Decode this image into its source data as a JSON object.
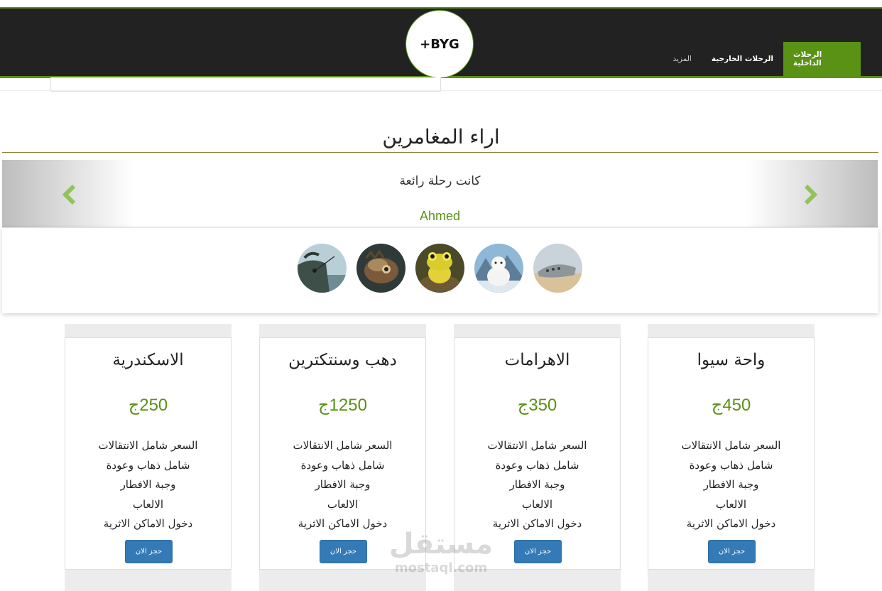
{
  "header": {
    "logo_text": "+BYG",
    "nav": [
      {
        "label": "الرحلات الداخلية",
        "active": true
      },
      {
        "label": "الرحلات الخارجية",
        "active": false
      },
      {
        "label": "المزيد",
        "active": false
      }
    ]
  },
  "testimonials": {
    "title": "اراء المغامرين",
    "quote": "كانت رحلة رائعة",
    "author": "Ahmed",
    "avatars": [
      "fisherman-photo",
      "steampunk-fish-photo",
      "frog-photo",
      "polar-bear-photo",
      "crashed-plane-photo"
    ]
  },
  "cards": [
    {
      "title": "واحة سيوا",
      "price": "450ج",
      "features": [
        "السعر شامل الانتقالات",
        "شامل ذهاب وعودة",
        "وجبة الافطار",
        "الالعاب",
        "دخول الاماكن الاثرية"
      ],
      "button": "حجز الان"
    },
    {
      "title": "الاهرامات",
      "price": "350ج",
      "features": [
        "السعر شامل الانتقالات",
        "شامل ذهاب وعودة",
        "وجبة الافطار",
        "الالعاب",
        "دخول الاماكن الاثرية"
      ],
      "button": "حجز الان"
    },
    {
      "title": "دهب وسنتكترين",
      "price": "1250ج",
      "features": [
        "السعر شامل الانتقالات",
        "شامل ذهاب وعودة",
        "وجبة الافطار",
        "الالعاب",
        "دخول الاماكن الاثرية"
      ],
      "button": "حجز الان"
    },
    {
      "title": "الاسكندرية",
      "price": "250ج",
      "features": [
        "السعر شامل الانتقالات",
        "شامل ذهاب وعودة",
        "وجبة الافطار",
        "الالعاب",
        "دخول الاماكن الاثرية"
      ],
      "button": "حجز الان"
    }
  ],
  "watermark": {
    "arabic": "مستقل",
    "latin": "mostaql.com"
  },
  "colors": {
    "accent": "#5a9216",
    "header_bg": "#222222",
    "button": "#337ab7"
  }
}
